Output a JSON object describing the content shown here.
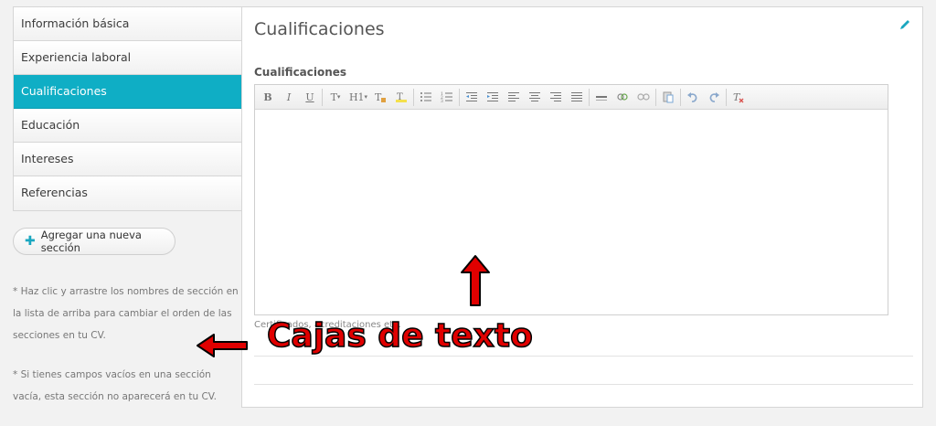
{
  "sidebar": {
    "items": [
      {
        "label": "Información básica"
      },
      {
        "label": "Experiencia laboral"
      },
      {
        "label": "Cualificaciones"
      },
      {
        "label": "Educación"
      },
      {
        "label": "Intereses"
      },
      {
        "label": "Referencias"
      }
    ],
    "active_index": 2,
    "add_button_label": "Agregar una nueva sección",
    "note_reorder": "* Haz clic y arrastre los nombres de sección en la lista de arriba para cambiar el orden de las secciones en tu CV.",
    "note_empty": "* Si tienes campos vacíos en una sección vacía, esta sección no aparecerá en tu CV."
  },
  "main": {
    "title": "Cualificaciones",
    "field_label": "Cualificaciones",
    "field_value": "",
    "help_text": "Certificados, acreditaciones etc."
  },
  "annotation": {
    "text": "Cajas de texto",
    "color": "#e00000"
  },
  "colors": {
    "accent": "#0faec5"
  },
  "toolbar_icons": [
    "bold-icon",
    "italic-icon",
    "underline-icon",
    "text-style-icon",
    "heading-icon",
    "text-color-icon",
    "highlight-icon",
    "bullet-list-icon",
    "numbered-list-icon",
    "outdent-icon",
    "indent-icon",
    "align-left-icon",
    "align-center-icon",
    "align-right-icon",
    "justify-icon",
    "horizontal-rule-icon",
    "link-icon",
    "unlink-icon",
    "paste-icon",
    "undo-icon",
    "redo-icon",
    "clear-format-icon"
  ]
}
